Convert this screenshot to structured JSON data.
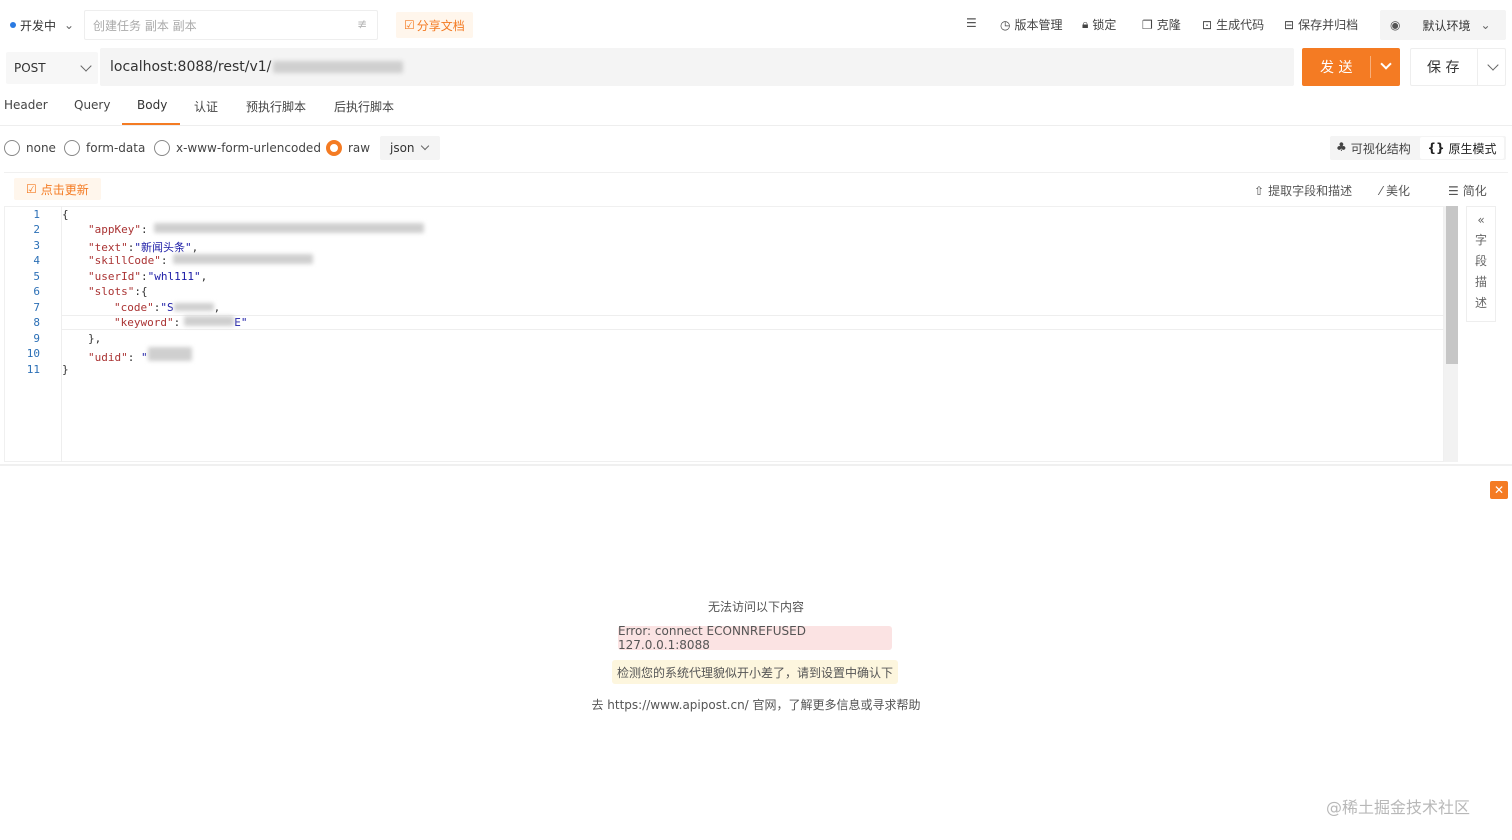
{
  "topbar": {
    "status_label": "开发中",
    "task_placeholder": "创建任务 副本 副本",
    "share_label": "分享文档",
    "tools": [
      {
        "label": "版本管理"
      },
      {
        "label": "锁定"
      },
      {
        "label": "克隆"
      },
      {
        "label": "生成代码"
      },
      {
        "label": "保存并归档"
      }
    ],
    "env_label": "默认环境"
  },
  "request": {
    "method": "POST",
    "url": "localhost:8088/rest/v1/",
    "send_label": "发 送",
    "save_label": "保 存"
  },
  "tabs": [
    "Header",
    "Query",
    "Body",
    "认证",
    "预执行脚本",
    "后执行脚本"
  ],
  "body_types": [
    "none",
    "form-data",
    "x-www-form-urlencoded",
    "raw"
  ],
  "format": "json",
  "modes": {
    "visual": "可视化结构",
    "raw": "原生模式"
  },
  "editor_toolbar": {
    "refresh": "点击更新",
    "extract": "提取字段和描述",
    "beautify": "美化",
    "simplify": "简化"
  },
  "code": {
    "line_numbers": [
      "1",
      "2",
      "3",
      "4",
      "5",
      "6",
      "7",
      "8",
      "9",
      "10",
      "11"
    ],
    "l1": "{",
    "l2_key": "\"appKey\"",
    "l3_key": "\"text\"",
    "l3_val": "\"新闻头条\"",
    "l4_key": "\"skillCode\"",
    "l5_key": "\"userId\"",
    "l5_val": "\"whl111\"",
    "l6_key": "\"slots\"",
    "l7_key": "\"code\"",
    "l7_val": "\"S",
    "l8_key": "\"keyword\"",
    "l8_val": "E\"",
    "l9": "},",
    "l10_key": "\"udid\"",
    "l10_val": "\"",
    "l11": "}"
  },
  "side_panel_chars": [
    "字",
    "段",
    "描",
    "述"
  ],
  "response": {
    "title": "无法访问以下内容",
    "error": "Error: connect ECONNREFUSED 127.0.0.1:8088",
    "warning": "检测您的系统代理貌似开小差了，请到设置中确认下",
    "help": "去 https://www.apipost.cn/ 官网，了解更多信息或寻求帮助"
  },
  "watermark": "@稀土掘金技术社区",
  "colors": {
    "accent": "#f47b23",
    "error_bg": "#fbe3e3",
    "warn_bg": "#fdf6de"
  }
}
